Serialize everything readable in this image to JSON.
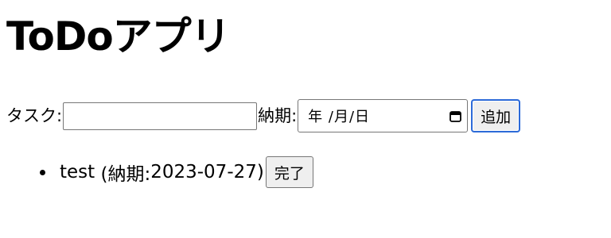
{
  "app": {
    "title": "ToDoアプリ"
  },
  "form": {
    "task_label": "タスク:",
    "task_value": "",
    "due_label": "納期:",
    "date_display": "年 /月/日",
    "add_button": "追加"
  },
  "todos": [
    {
      "text": "test",
      "due_prefix": "(納期: ",
      "due_date": "2023-07-27",
      "due_suffix": ")",
      "done_button": "完了"
    }
  ],
  "icons": {
    "calendar": "calendar-icon"
  }
}
